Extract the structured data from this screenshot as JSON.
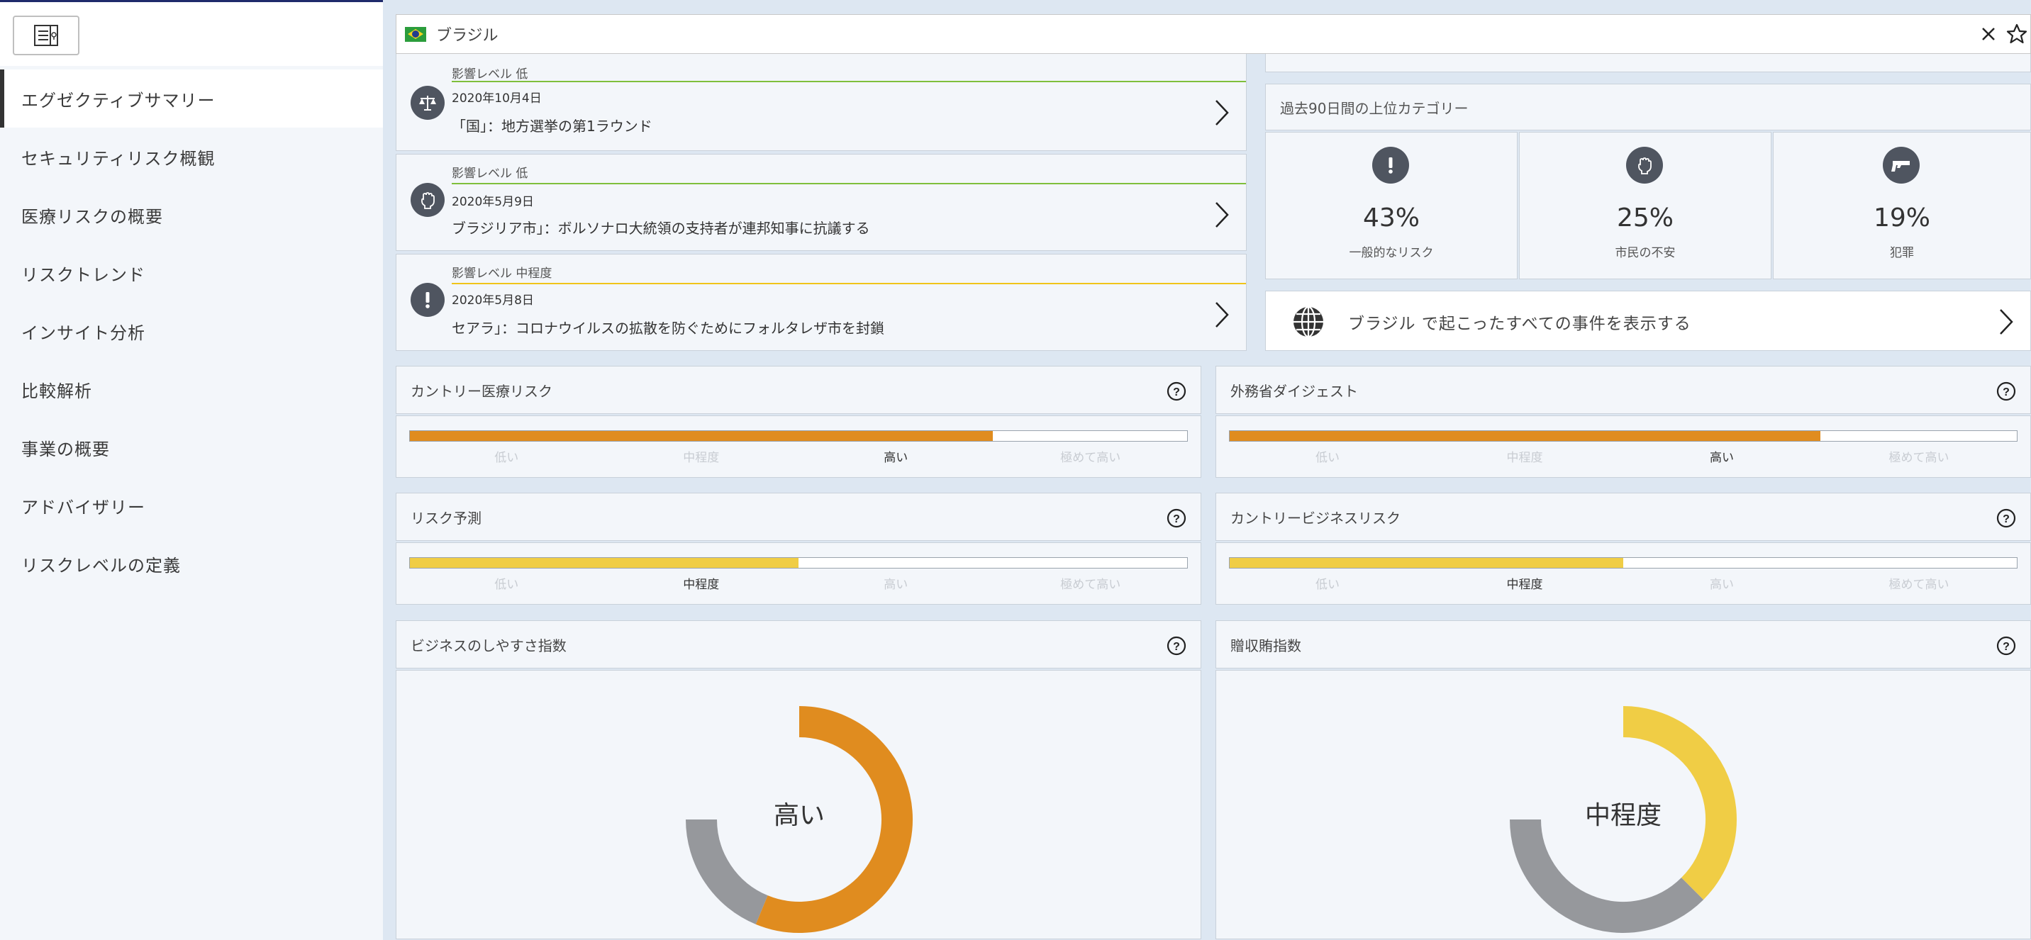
{
  "search": {
    "country": "ブラジル"
  },
  "sidebar": {
    "items": [
      {
        "label": "エグゼクティブサマリー",
        "active": true
      },
      {
        "label": "セキュリティリスク概観"
      },
      {
        "label": "医療リスクの概要"
      },
      {
        "label": "リスクトレンド"
      },
      {
        "label": "インサイト分析"
      },
      {
        "label": "比較解析"
      },
      {
        "label": "事業の概要"
      },
      {
        "label": "アドバイザリー"
      },
      {
        "label": "リスクレベルの定義"
      }
    ]
  },
  "events": [
    {
      "level": "影響レベル 低",
      "date": "2020年10月4日",
      "title": "「国」：地方選挙の第1ラウンド",
      "icon": "scales-icon",
      "line_color": "#7fbf3b"
    },
    {
      "level": "影響レベル 低",
      "date": "2020年5月9日",
      "title": "ブラジリア市」：ボルソナロ大統領の支持者が連邦知事に抗議する",
      "icon": "fist-icon",
      "line_color": "#7fbf3b"
    },
    {
      "level": "影響レベル 中程度",
      "date": "2020年5月8日",
      "title": "セアラ」：コロナウイルスの拡散を防ぐためにフォルタレザ市を封鎖",
      "icon": "exclamation-icon",
      "line_color": "#f0c419"
    }
  ],
  "top_categories": {
    "header": "過去90日間の上位カテゴリー",
    "items": [
      {
        "pct": "43%",
        "label": "一般的なリスク",
        "icon": "exclamation-icon"
      },
      {
        "pct": "25%",
        "label": "市民の不安",
        "icon": "fist-icon"
      },
      {
        "pct": "19%",
        "label": "犯罪",
        "icon": "gun-icon"
      }
    ]
  },
  "all_events": {
    "label": "ブラジル で起こったすべての事件を表示する"
  },
  "scale_labels": [
    "低い",
    "中程度",
    "高い",
    "極めて高い"
  ],
  "panels": {
    "medical": {
      "title": "カントリー医療リスク",
      "level_index": 2,
      "fill": 0.75,
      "color": "#e08c1f"
    },
    "mofa": {
      "title": "外務省ダイジェスト",
      "level_index": 2,
      "fill": 0.75,
      "color": "#e08c1f"
    },
    "forecast": {
      "title": "リスク予測",
      "level_index": 1,
      "fill": 0.5,
      "color": "#f0cd45"
    },
    "business": {
      "title": "カントリービジネスリスク",
      "level_index": 1,
      "fill": 0.5,
      "color": "#f0cd45"
    },
    "ease": {
      "title": "ビジネスのしやすさ指数",
      "value_label": "高い",
      "fraction": 0.75,
      "color": "#e08c1f"
    },
    "bribery": {
      "title": "贈収賄指数",
      "value_label": "中程度",
      "fraction": 0.5,
      "color": "#f0cd45"
    }
  },
  "colors": {
    "track": "#96989c",
    "icon_bg": "#4f5560"
  }
}
